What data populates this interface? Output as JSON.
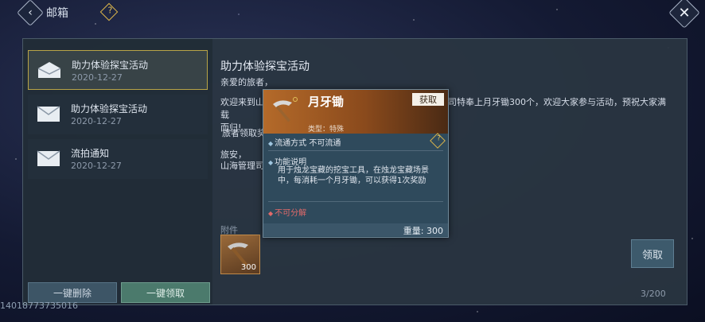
{
  "header": {
    "title": "邮箱",
    "back_icon": "back-arrow-icon",
    "help_icon": "help-icon",
    "close_icon": "close-icon"
  },
  "mail_list": [
    {
      "title": "助力体验探宝活动",
      "date": "2020-12-27",
      "selected": true
    },
    {
      "title": "助力体验探宝活动",
      "date": "2020-12-27",
      "selected": false
    },
    {
      "title": "流拍通知",
      "date": "2020-12-27",
      "selected": false
    }
  ],
  "buttons": {
    "delete_all": "一键删除",
    "claim_all": "一键领取",
    "claim": "领取"
  },
  "user_id": "14018773735016",
  "mail": {
    "heading": "助力体验探宝活动",
    "greeting": "亲爱的旅者，",
    "body_left": "欢迎来到山",
    "body_right": "司特奉上月牙锄300个，欢迎大家参与活动，预祝大家满载",
    "body_end": "而归!",
    "line2": "旅者领取奖",
    "sign1": "旅安，",
    "sign2": "山海管理司",
    "attachment_label": "附件",
    "attachment_count": "300",
    "mail_count": "3/200"
  },
  "tooltip": {
    "name": "月牙锄",
    "get_button": "获取",
    "type": "类型：特殊",
    "trade": "流通方式   不可流通",
    "function_title": "功能说明",
    "function_desc": "用于烛龙宝藏的挖宝工具，在烛龙宝藏场景中，每消耗一个月牙锄，可以获得1次奖励",
    "no_decompose": "不可分解",
    "weight": "重量: 300"
  }
}
